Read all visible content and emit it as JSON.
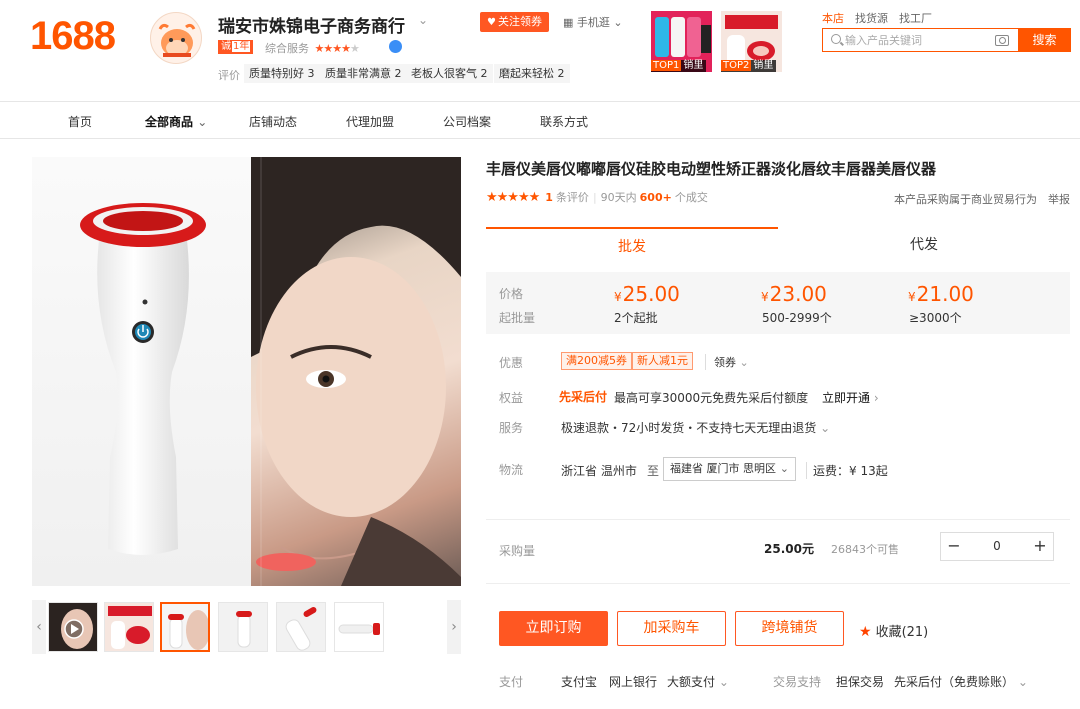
{
  "header": {
    "logo": "1688",
    "shop_name": "瑞安市姝锦电子商务商行",
    "follow_label": "关注领券",
    "mobile_label": "手机逛",
    "years_badge": "1年",
    "composite_label": "综合服务",
    "composite_stars": 3.5,
    "review_label": "评价",
    "review_tags": [
      "质量特别好 3",
      "质量非常满意 2",
      "老板人很客气 2",
      "磨起来轻松 2"
    ],
    "top_products": [
      {
        "rank": "TOP1",
        "text": "销里"
      },
      {
        "rank": "TOP2",
        "text": "销里"
      }
    ],
    "search_tabs": [
      "本店",
      "找货源",
      "找工厂"
    ],
    "search_placeholder": "输入产品关键词",
    "search_button": "搜索"
  },
  "nav": {
    "items": [
      "首页",
      "全部商品",
      "店铺动态",
      "代理加盟",
      "公司档案",
      "联系方式"
    ]
  },
  "product": {
    "title": "丰唇仪美唇仪嘟嘟唇仪硅胶电动塑性矫正器淡化唇纹丰唇器美唇仪器",
    "rating_stars": 5,
    "review_count": "1",
    "review_suffix": "条评价",
    "days_label": "90天内",
    "sold": "600+",
    "sold_suffix": "个成交",
    "trade_note": "本产品采购属于商业贸易行为",
    "report": "举报"
  },
  "tabs": {
    "wholesale": "批发",
    "dropship": "代发"
  },
  "pricing": {
    "price_label": "价格",
    "min_label": "起批量",
    "currency": "¥",
    "tiers": [
      {
        "price": "25.00",
        "qty": "2个起批"
      },
      {
        "price": "23.00",
        "qty": "500-2999个"
      },
      {
        "price": "21.00",
        "qty": "≥3000个"
      }
    ]
  },
  "offers": {
    "label": "优惠",
    "coupons": [
      "满200减5券",
      "新人减1元"
    ],
    "get_coupon": "领券"
  },
  "benefits": {
    "label": "权益",
    "tag": "先采后付",
    "text": "最高可享30000元免费先采后付额度",
    "link": "立即开通"
  },
  "service": {
    "label": "服务",
    "text": "极速退款・72小时发货・不支持七天无理由退货"
  },
  "logistics": {
    "label": "物流",
    "from": "浙江省 温州市",
    "to": "至",
    "destination": "福建省 厦门市 思明区",
    "freight": "运费：¥ 13起"
  },
  "purchase": {
    "label": "采购量",
    "price": "25.00元",
    "stock": "26843个可售",
    "quantity": "0",
    "minus": "−",
    "plus": "+"
  },
  "actions": {
    "order": "立即订购",
    "cart": "加采购车",
    "crossborder": "跨境铺货",
    "favorite": "收藏(21)"
  },
  "payment": {
    "label": "支付",
    "methods": [
      "支付宝",
      "网上银行",
      "大额支付"
    ],
    "support_label": "交易支持",
    "support": [
      "担保交易",
      "先采后付（免费赊账）"
    ]
  },
  "colors": {
    "accent": "#ff5500",
    "button": "#ff5722"
  }
}
